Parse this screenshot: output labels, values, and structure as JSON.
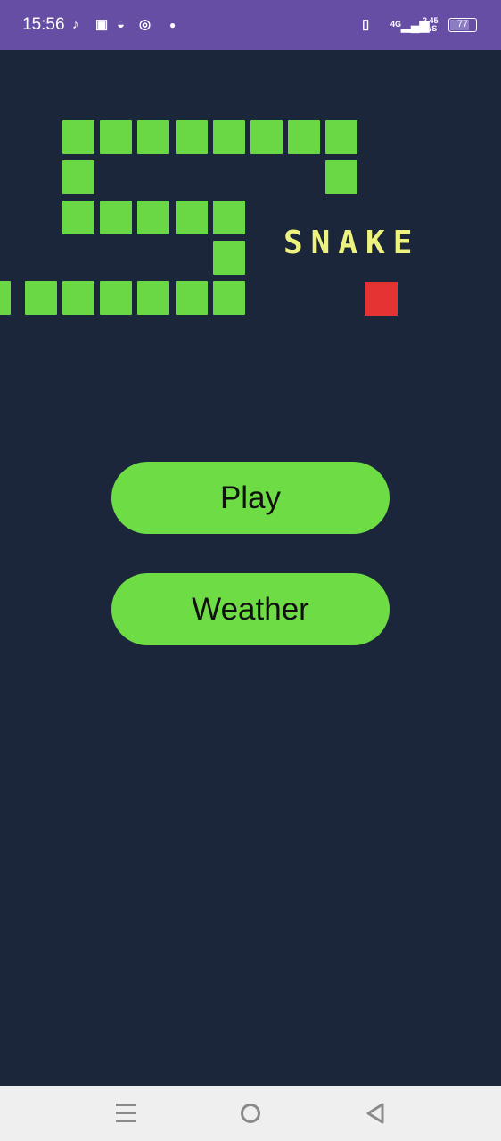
{
  "status_bar": {
    "time": "15:56",
    "notification_icons": [
      "tiktok-icon",
      "office-icon",
      "reddit-icon",
      "instagram-icon",
      "dot-icon"
    ],
    "network_type": "4G",
    "data_speed": "2,45",
    "data_speed_unit": "K/S",
    "battery": "77"
  },
  "logo": {
    "text": "SNAKE"
  },
  "menu": {
    "play_label": "Play",
    "weather_label": "Weather"
  },
  "colors": {
    "background": "#1c263a",
    "accent": "#6ddc45",
    "status_bar": "#654ea3",
    "apple": "#e53333"
  }
}
